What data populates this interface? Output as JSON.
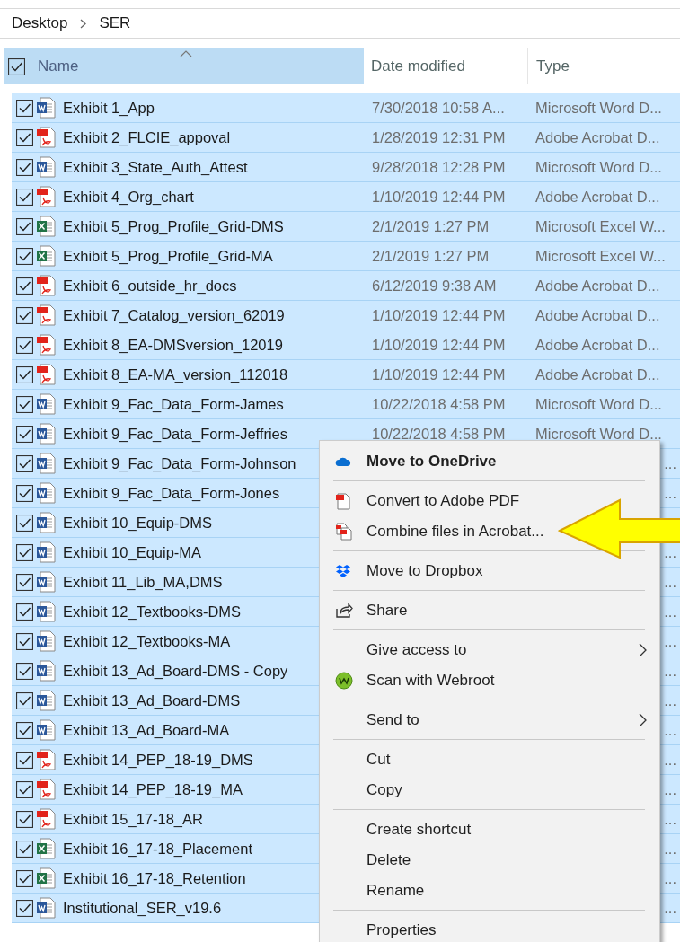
{
  "breadcrumb": [
    "Desktop",
    "SER"
  ],
  "header": {
    "checked": true,
    "columns": [
      {
        "label": "Name",
        "selected": true
      },
      {
        "label": "Date modified",
        "selected": false
      },
      {
        "label": "Type",
        "selected": false
      }
    ]
  },
  "rows": [
    {
      "name": "Exhibit 1_App",
      "kind": "word",
      "checked": true,
      "selected": true,
      "date": "7/30/2018 10:58 A...",
      "type": "Microsoft Word D..."
    },
    {
      "name": "Exhibit 2_FLCIE_appoval",
      "kind": "pdf",
      "checked": true,
      "selected": true,
      "date": "1/28/2019 12:31 PM",
      "type": "Adobe Acrobat D..."
    },
    {
      "name": "Exhibit 3_State_Auth_Attest",
      "kind": "word",
      "checked": true,
      "selected": true,
      "date": "9/28/2018 12:28 PM",
      "type": "Microsoft Word D..."
    },
    {
      "name": "Exhibit 4_Org_chart",
      "kind": "pdf",
      "checked": true,
      "selected": true,
      "date": "1/10/2019 12:44 PM",
      "type": "Adobe Acrobat D..."
    },
    {
      "name": "Exhibit 5_Prog_Profile_Grid-DMS",
      "kind": "excel",
      "checked": true,
      "selected": true,
      "date": "2/1/2019 1:27 PM",
      "type": "Microsoft Excel W..."
    },
    {
      "name": "Exhibit 5_Prog_Profile_Grid-MA",
      "kind": "excel",
      "checked": true,
      "selected": true,
      "date": "2/1/2019 1:27 PM",
      "type": "Microsoft Excel W..."
    },
    {
      "name": "Exhibit 6_outside_hr_docs",
      "kind": "pdf",
      "checked": true,
      "selected": true,
      "date": "6/12/2019 9:38 AM",
      "type": "Adobe Acrobat D..."
    },
    {
      "name": "Exhibit 7_Catalog_version_62019",
      "kind": "pdf",
      "checked": true,
      "selected": true,
      "date": "1/10/2019 12:44 PM",
      "type": "Adobe Acrobat D..."
    },
    {
      "name": "Exhibit 8_EA-DMSversion_12019",
      "kind": "pdf",
      "checked": true,
      "selected": true,
      "date": "1/10/2019 12:44 PM",
      "type": "Adobe Acrobat D..."
    },
    {
      "name": "Exhibit 8_EA-MA_version_112018",
      "kind": "pdf",
      "checked": true,
      "selected": true,
      "date": "1/10/2019 12:44 PM",
      "type": "Adobe Acrobat D..."
    },
    {
      "name": "Exhibit 9_Fac_Data_Form-James",
      "kind": "word",
      "checked": true,
      "selected": true,
      "date": "10/22/2018 4:58 PM",
      "type": "Microsoft Word D..."
    },
    {
      "name": "Exhibit 9_Fac_Data_Form-Jeffries",
      "kind": "word",
      "checked": true,
      "selected": true,
      "date": "10/22/2018 4:58 PM",
      "type": "Microsoft Word D..."
    },
    {
      "name": "Exhibit 9_Fac_Data_Form-Johnson",
      "kind": "word",
      "checked": true,
      "selected": true,
      "type": "..."
    },
    {
      "name": "Exhibit 9_Fac_Data_Form-Jones",
      "kind": "word",
      "checked": true,
      "selected": true,
      "type": "..."
    },
    {
      "name": "Exhibit 10_Equip-DMS",
      "kind": "word",
      "checked": true,
      "selected": true
    },
    {
      "name": "Exhibit 10_Equip-MA",
      "kind": "word",
      "checked": true,
      "selected": true,
      "type": "..."
    },
    {
      "name": "Exhibit 11_Lib_MA,DMS",
      "kind": "word",
      "checked": true,
      "selected": true,
      "type": "..."
    },
    {
      "name": "Exhibit 12_Textbooks-DMS",
      "kind": "word",
      "checked": true,
      "selected": true,
      "type": "..."
    },
    {
      "name": "Exhibit 12_Textbooks-MA",
      "kind": "word",
      "checked": true,
      "selected": true,
      "type": "..."
    },
    {
      "name": "Exhibit 13_Ad_Board-DMS - Copy",
      "kind": "word",
      "checked": true,
      "selected": true,
      "type": "..."
    },
    {
      "name": "Exhibit 13_Ad_Board-DMS",
      "kind": "word",
      "checked": true,
      "selected": true,
      "type": "..."
    },
    {
      "name": "Exhibit 13_Ad_Board-MA",
      "kind": "word",
      "checked": true,
      "selected": true,
      "type": "..."
    },
    {
      "name": "Exhibit 14_PEP_18-19_DMS",
      "kind": "pdf",
      "checked": true,
      "selected": true,
      "type": "..."
    },
    {
      "name": "Exhibit 14_PEP_18-19_MA",
      "kind": "pdf",
      "checked": true,
      "selected": true,
      "type": "..."
    },
    {
      "name": "Exhibit 15_17-18_AR",
      "kind": "pdf",
      "checked": true,
      "selected": true,
      "type": "..."
    },
    {
      "name": "Exhibit 16_17-18_Placement",
      "kind": "excel",
      "checked": true,
      "selected": true,
      "type": "..."
    },
    {
      "name": "Exhibit 16_17-18_Retention",
      "kind": "excel",
      "checked": true,
      "selected": true,
      "type": "..."
    },
    {
      "name": "Institutional_SER_v19.6",
      "kind": "word",
      "checked": true,
      "selected": true,
      "type": "..."
    }
  ],
  "context_menu": [
    {
      "kind": "onedrive",
      "label": "Move to OneDrive",
      "bold": true
    },
    {
      "kind": "separator"
    },
    {
      "kind": "convert",
      "label": "Convert to Adobe PDF"
    },
    {
      "kind": "combine",
      "label": "Combine files in Acrobat..."
    },
    {
      "kind": "separator"
    },
    {
      "kind": "dropbox",
      "label": "Move to Dropbox"
    },
    {
      "kind": "separator"
    },
    {
      "kind": "share",
      "label": "Share"
    },
    {
      "kind": "separator"
    },
    {
      "kind": "item",
      "label": "Give access to",
      "submenu": true
    },
    {
      "kind": "webroot",
      "label": "Scan with Webroot"
    },
    {
      "kind": "separator"
    },
    {
      "kind": "item",
      "label": "Send to",
      "submenu": true
    },
    {
      "kind": "separator"
    },
    {
      "kind": "item",
      "label": "Cut"
    },
    {
      "kind": "item",
      "label": "Copy"
    },
    {
      "kind": "separator"
    },
    {
      "kind": "item",
      "label": "Create shortcut"
    },
    {
      "kind": "item",
      "label": "Delete"
    },
    {
      "kind": "item",
      "label": "Rename"
    },
    {
      "kind": "separator"
    },
    {
      "kind": "item",
      "label": "Properties"
    }
  ]
}
